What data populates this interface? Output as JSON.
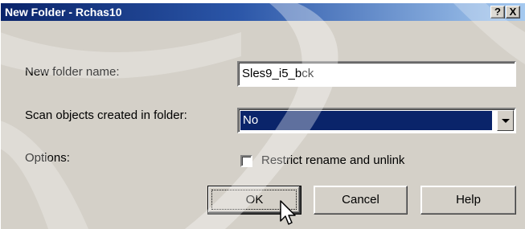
{
  "window": {
    "title": "New Folder - Rchas10",
    "help_button": "?",
    "close_button": "X"
  },
  "form": {
    "name_label": "New folder name:",
    "name_value": "Sles9_i5_bck",
    "scan_label": "Scan objects created in folder:",
    "scan_value": "No",
    "options_label": "Options:",
    "restrict_label": "Restrict rename and unlink",
    "restrict_checked": false
  },
  "buttons": {
    "ok": "OK",
    "cancel": "Cancel",
    "help": "Help"
  },
  "icons": {
    "dropdown": "chevron-down-icon",
    "cursor": "mouse-pointer-icon"
  },
  "colors": {
    "dialog_background": "#d4d0c8",
    "title_start": "#0a246a",
    "title_end": "#a6caf0",
    "selection": "#0a246a"
  }
}
